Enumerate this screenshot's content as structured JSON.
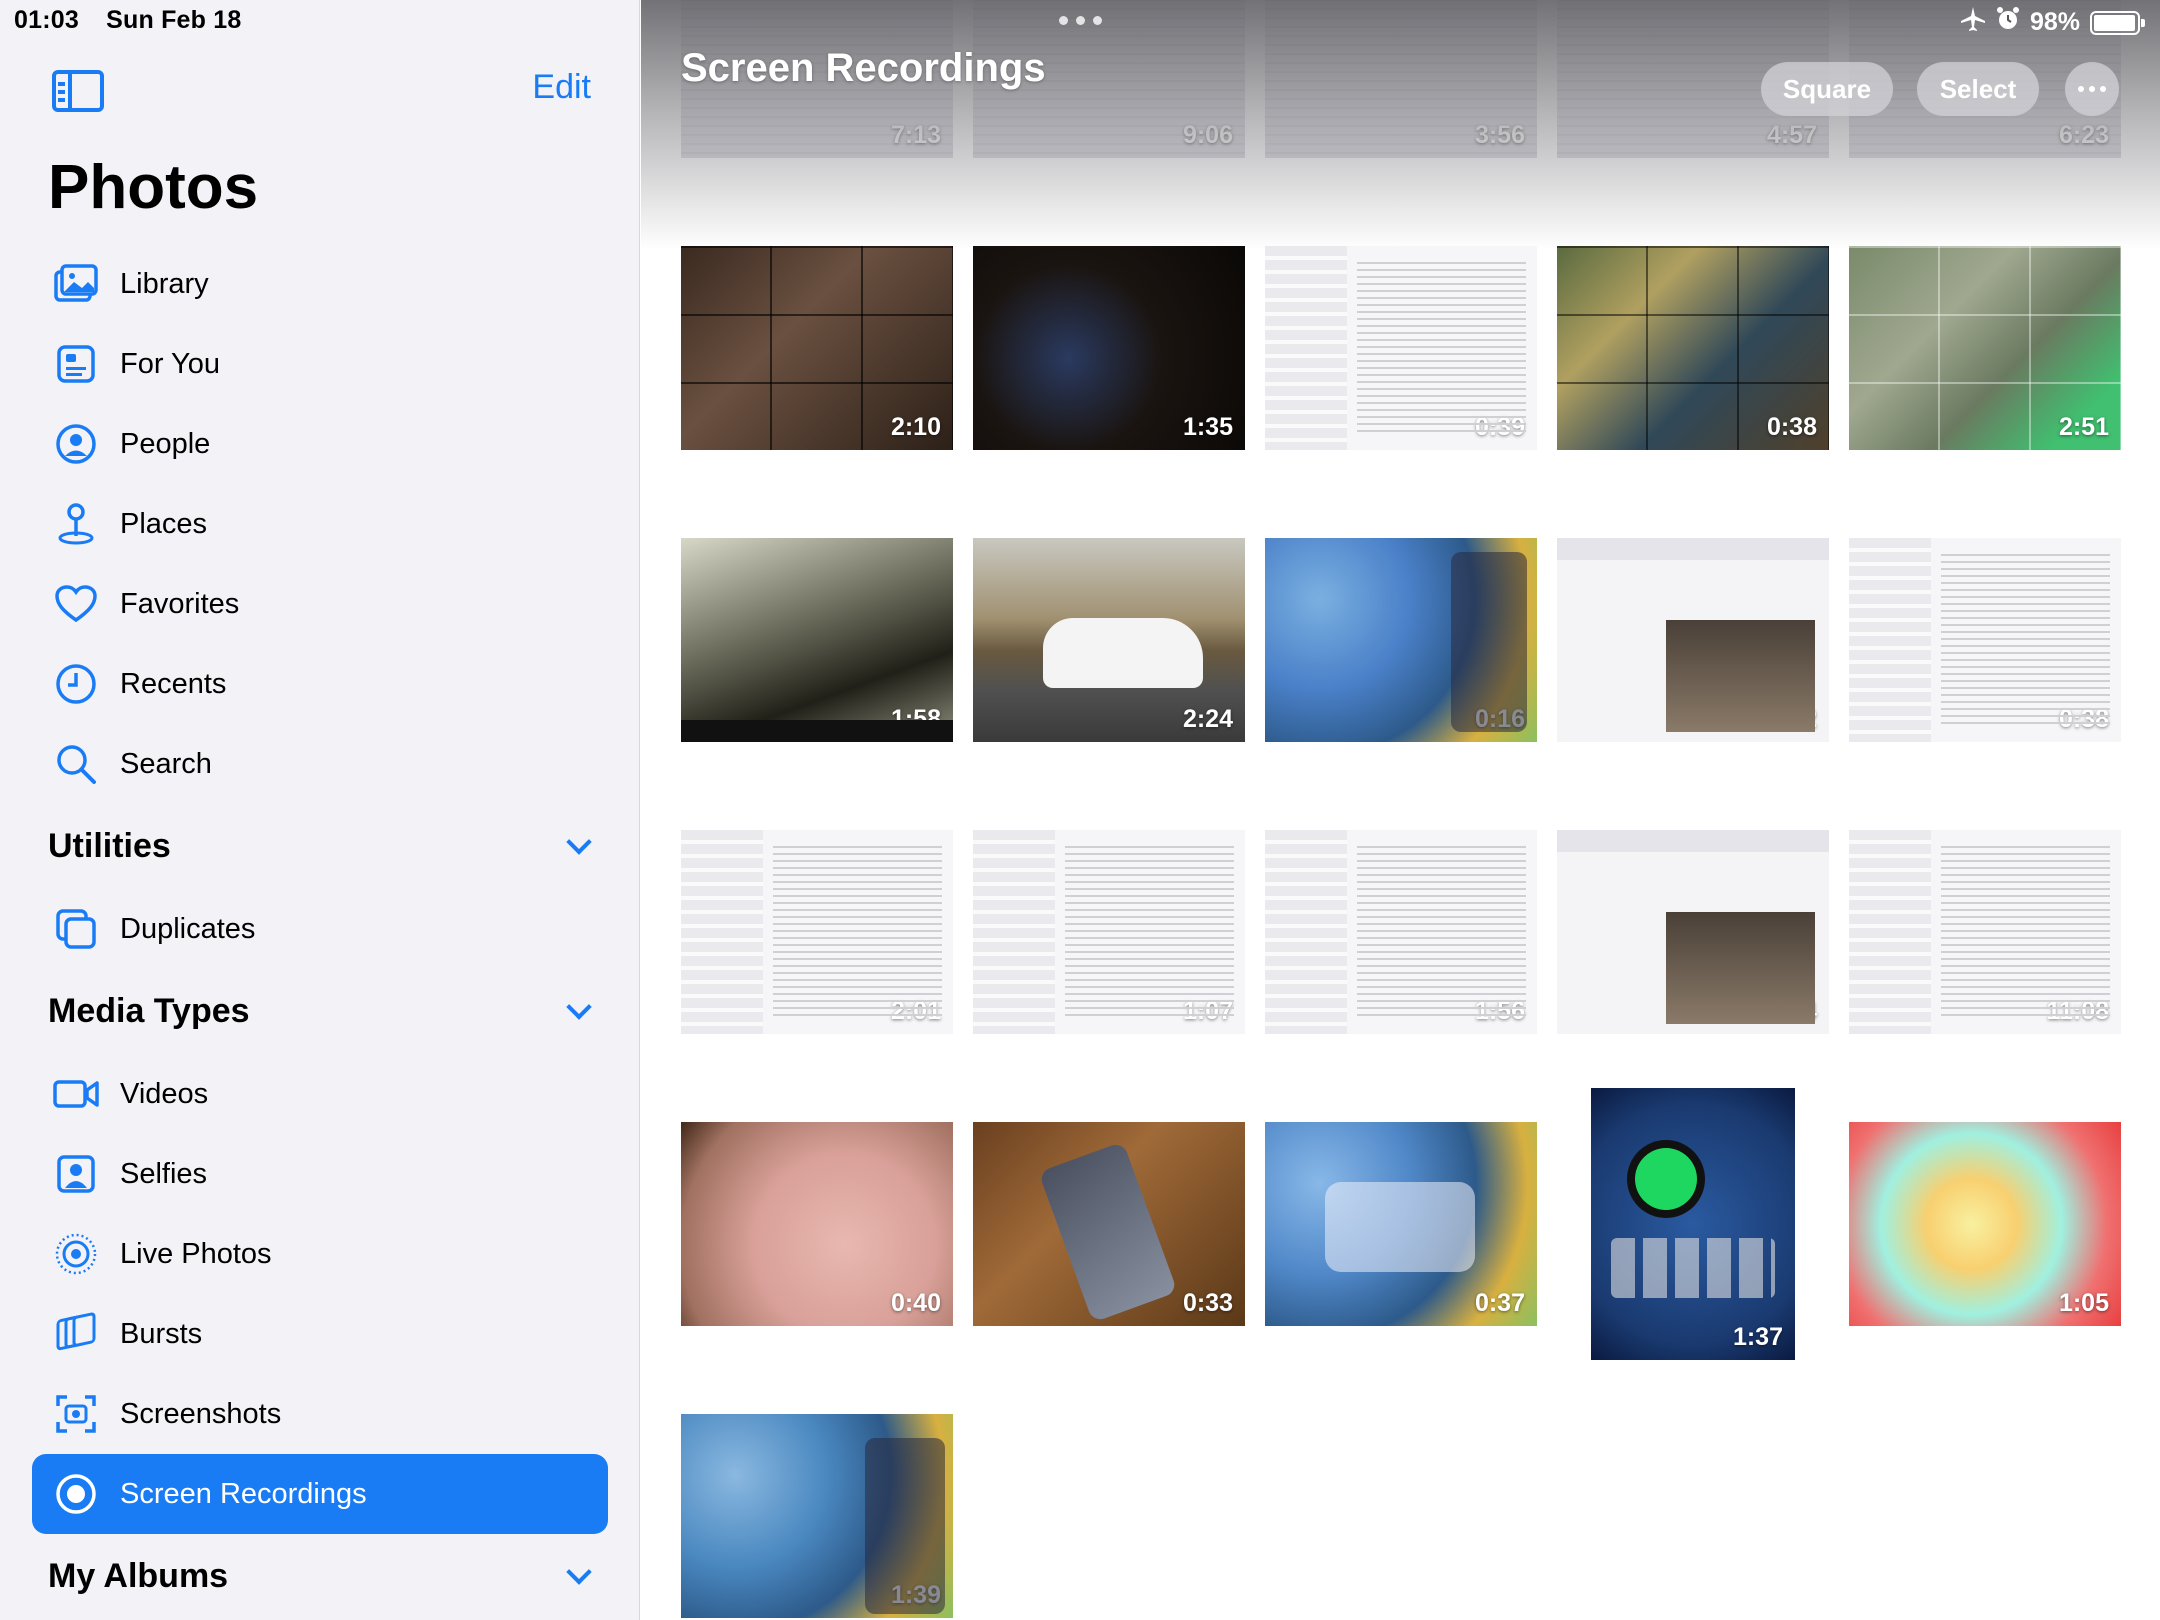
{
  "status": {
    "time": "01:03",
    "date": "Sun Feb 18",
    "battery": "98%",
    "battery_level": 0.98
  },
  "sidebar": {
    "edit": "Edit",
    "title": "Photos",
    "items": [
      {
        "label": "Library",
        "icon": "photo-stack-icon"
      },
      {
        "label": "For You",
        "icon": "for-you-icon"
      },
      {
        "label": "People",
        "icon": "person-circle-icon"
      },
      {
        "label": "Places",
        "icon": "map-pin-icon"
      },
      {
        "label": "Favorites",
        "icon": "heart-icon"
      },
      {
        "label": "Recents",
        "icon": "clock-icon"
      },
      {
        "label": "Search",
        "icon": "magnifier-icon"
      }
    ],
    "utilities": {
      "label": "Utilities",
      "items": [
        {
          "label": "Duplicates",
          "icon": "duplicate-icon"
        }
      ]
    },
    "media_types": {
      "label": "Media Types",
      "items": [
        {
          "label": "Videos",
          "icon": "video-icon"
        },
        {
          "label": "Selfies",
          "icon": "selfie-icon"
        },
        {
          "label": "Live Photos",
          "icon": "live-photo-icon"
        },
        {
          "label": "Bursts",
          "icon": "burst-icon"
        },
        {
          "label": "Screenshots",
          "icon": "screenshot-icon"
        },
        {
          "label": "Screen Recordings",
          "icon": "screen-record-icon",
          "selected": true
        }
      ]
    },
    "my_albums": {
      "label": "My Albums"
    },
    "accent": "#1a7cf5"
  },
  "main": {
    "title": "Screen Recordings",
    "buttons": {
      "square": "Square",
      "select": "Select"
    },
    "top_row": [
      "7:13",
      "9:06",
      "3:56",
      "4:57",
      "6:23"
    ],
    "grid": [
      [
        "2:10",
        "1:35",
        "0:39",
        "0:38",
        "2:51"
      ],
      [
        "1:58",
        "2:24",
        "0:16",
        "7:22",
        "0:38"
      ],
      [
        "2:01",
        "1:07",
        "1:56",
        "28:44",
        "11:08"
      ],
      [
        "0:40",
        "0:33",
        "0:37",
        "1:37",
        "1:05"
      ],
      [
        "1:39"
      ]
    ]
  }
}
